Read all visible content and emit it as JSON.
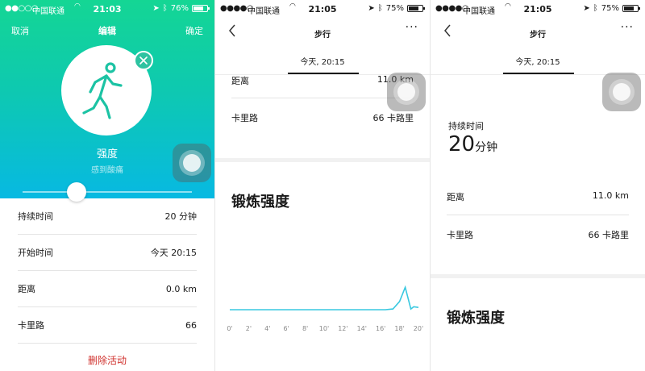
{
  "status_bars": [
    {
      "signal": "●●○○○",
      "carrier": "中国联通",
      "time": "21:03",
      "battery": "76%",
      "battery_level": 0.76
    },
    {
      "signal": "●●●●○",
      "carrier": "中国联通",
      "time": "21:05",
      "battery": "75%",
      "battery_level": 0.75
    },
    {
      "signal": "●●●●○",
      "carrier": "中国联通",
      "time": "21:05",
      "battery": "75%",
      "battery_level": 0.75
    }
  ],
  "edit_screen": {
    "nav": {
      "cancel": "取消",
      "title": "编辑",
      "confirm": "确定"
    },
    "intensity_label": "强度",
    "intensity_hint": "感到酸痛",
    "slider_level": 0.32,
    "rows": [
      {
        "label": "持续时间",
        "value": "20 分钟"
      },
      {
        "label": "开始时间",
        "value": "今天 20:15"
      },
      {
        "label": "距离",
        "value": "0.0 km"
      },
      {
        "label": "卡里路",
        "value": "66"
      }
    ],
    "delete_label": "删除活动"
  },
  "detail_screen": {
    "title": "步行",
    "more": "···",
    "segment": "今天, 20:15",
    "rows": [
      {
        "label": "距离",
        "value": "11.0 km"
      },
      {
        "label": "卡里路",
        "value": "66 卡路里"
      }
    ],
    "section_title": "锻炼强度"
  },
  "detail_screen_top": {
    "title": "步行",
    "more": "···",
    "segment": "今天, 20:15",
    "duration_label": "持续时间",
    "duration_number": "20",
    "duration_unit": "分钟",
    "rows": [
      {
        "label": "距离",
        "value": "11.0 km"
      },
      {
        "label": "卡里路",
        "value": "66 卡路里"
      }
    ],
    "section_title": "锻炼强度"
  },
  "chart_data": {
    "type": "line",
    "x_ticks": [
      "0'",
      "2'",
      "4'",
      "6'",
      "8'",
      "10'",
      "12'",
      "14'",
      "16'",
      "18'",
      "20'"
    ],
    "xlim": [
      0,
      20
    ],
    "ylim": [
      0,
      1
    ],
    "x": [
      0,
      16.5,
      17.3,
      18.0,
      18.6,
      19.2,
      19.5,
      20
    ],
    "y": [
      0,
      0,
      0.02,
      0.22,
      0.6,
      0.02,
      0.08,
      0.06
    ],
    "color": "#38c8e0",
    "grid": false
  }
}
